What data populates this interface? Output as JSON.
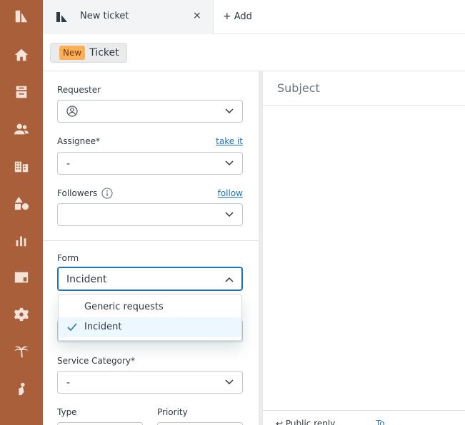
{
  "nav": {
    "icons": [
      "zendesk-logo-icon",
      "home-icon",
      "views-icon",
      "customers-icon",
      "organizations-icon",
      "objects-icon",
      "reporting-icon",
      "workspace-icon",
      "admin-gear-icon",
      "palm-tree-icon",
      "sandbox-icon"
    ]
  },
  "tabs": {
    "active_title": "New ticket",
    "close_glyph": "×",
    "add_label": "Add"
  },
  "status": {
    "badge": "New",
    "label": "Ticket"
  },
  "form": {
    "requester_label": "Requester",
    "assignee_label": "Assignee*",
    "assignee_link": "take it",
    "assignee_value": "-",
    "followers_label": "Followers",
    "followers_link": "follow",
    "form_label": "Form",
    "form_value": "Incident",
    "form_options": [
      "Generic requests",
      "Incident"
    ],
    "service_category_label": "Service Category*",
    "service_category_value": "-",
    "type_label": "Type",
    "priority_label": "Priority"
  },
  "content": {
    "subject_placeholder": "Subject",
    "reply_mode": "Public reply",
    "reply_to": "To"
  }
}
